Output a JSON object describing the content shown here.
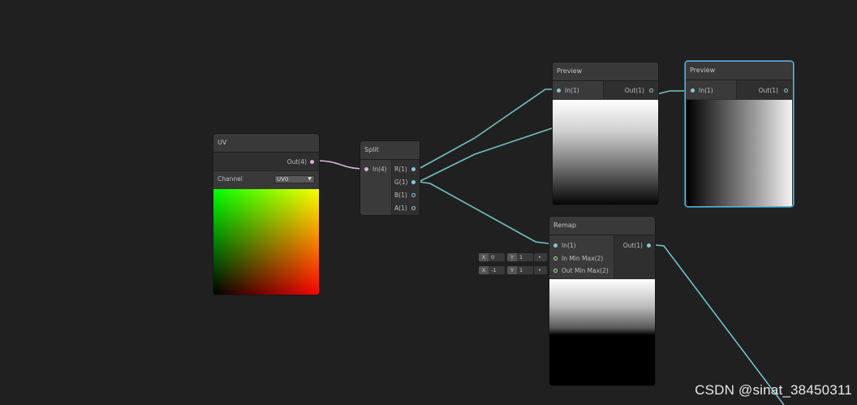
{
  "colors": {
    "wire_vector": "#72c1c5",
    "wire_uv": "#d6b6d3",
    "selection": "#5fb4d8",
    "background": "#202020"
  },
  "nodes": {
    "uv": {
      "title": "UV",
      "out_label": "Out(4)",
      "channel_label": "Channel",
      "channel_value": "UV0"
    },
    "split": {
      "title": "Split",
      "in_label": "In(4)",
      "outs": [
        "R(1)",
        "G(1)",
        "B(1)",
        "A(1)"
      ]
    },
    "preview1": {
      "title": "Preview",
      "in_label": "In(1)",
      "out_label": "Out(1)"
    },
    "preview2": {
      "title": "Preview",
      "in_label": "In(1)",
      "out_label": "Out(1)"
    },
    "remap": {
      "title": "Remap",
      "in_label": "In(1)",
      "in_minmax_label": "In Min Max(2)",
      "out_minmax_label": "Out Min Max(2)",
      "out_label": "Out(1)",
      "in_minmax": {
        "x_axis": "X",
        "x_value": "0",
        "y_axis": "Y",
        "y_value": "1"
      },
      "out_minmax": {
        "x_axis": "X",
        "x_value": "-1",
        "y_axis": "Y",
        "y_value": "1"
      }
    }
  },
  "watermark": "CSDN @sinat_38450311"
}
